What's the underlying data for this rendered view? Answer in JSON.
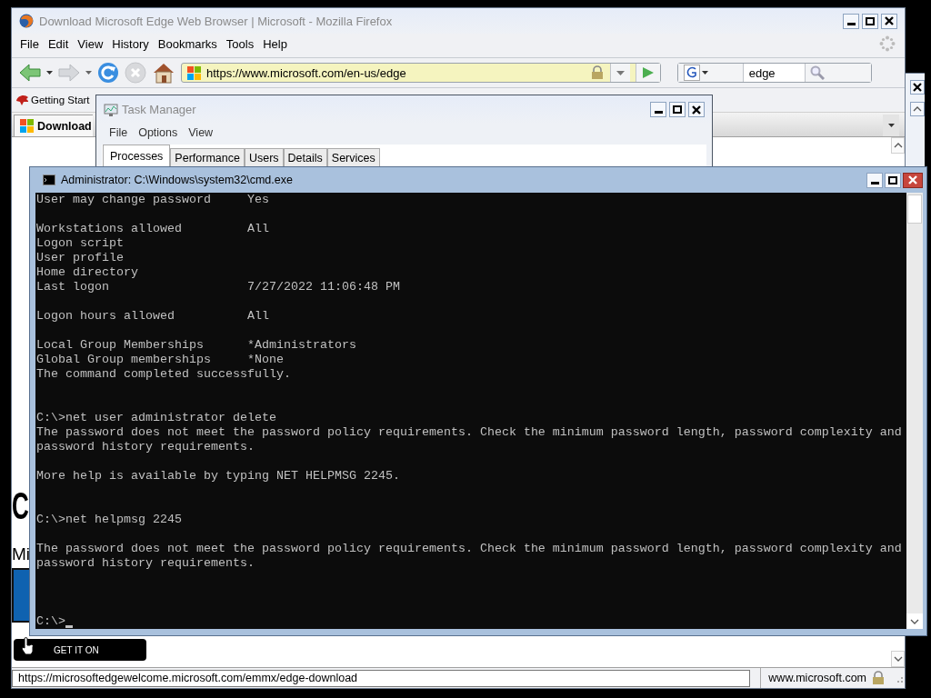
{
  "firefox": {
    "title": "Download Microsoft Edge Web Browser | Microsoft - Mozilla Firefox",
    "menu": [
      "File",
      "Edit",
      "View",
      "History",
      "Bookmarks",
      "Tools",
      "Help"
    ],
    "url": "https://www.microsoft.com/en-us/edge",
    "search": "edge",
    "bookmarks": [
      "Getting Start"
    ],
    "tabs": [
      {
        "label": "Download",
        "selected": true
      }
    ],
    "page": {
      "heading": "C",
      "subheading": "Mi",
      "badge": "GET IT ON"
    },
    "status": {
      "link": "https://microsoftedgewelcome.microsoft.com/emmx/edge-download",
      "domain": "www.microsoft.com"
    }
  },
  "task_manager": {
    "title": "Task Manager",
    "menu": [
      "File",
      "Options",
      "View"
    ],
    "tabs": [
      {
        "label": "Processes",
        "selected": true
      },
      {
        "label": "Performance",
        "selected": false
      },
      {
        "label": "Users",
        "selected": false
      },
      {
        "label": "Details",
        "selected": false
      },
      {
        "label": "Services",
        "selected": false
      }
    ]
  },
  "cmd": {
    "title": "Administrator: C:\\Windows\\system32\\cmd.exe",
    "output": "User may change password     Yes\n\nWorkstations allowed         All\nLogon script\nUser profile\nHome directory\nLast logon                   7/27/2022 11:06:48 PM\n\nLogon hours allowed          All\n\nLocal Group Memberships      *Administrators\nGlobal Group memberships     *None\nThe command completed successfully.\n\n\nC:\\>net user administrator delete\nThe password does not meet the password policy requirements. Check the minimum password length, password complexity and\npassword history requirements.\n\nMore help is available by typing NET HELPMSG 2245.\n\n\nC:\\>net helpmsg 2245\n\nThe password does not meet the password policy requirements. Check the minimum password length, password complexity and\npassword history requirements.",
    "prompt": "C:\\>"
  }
}
